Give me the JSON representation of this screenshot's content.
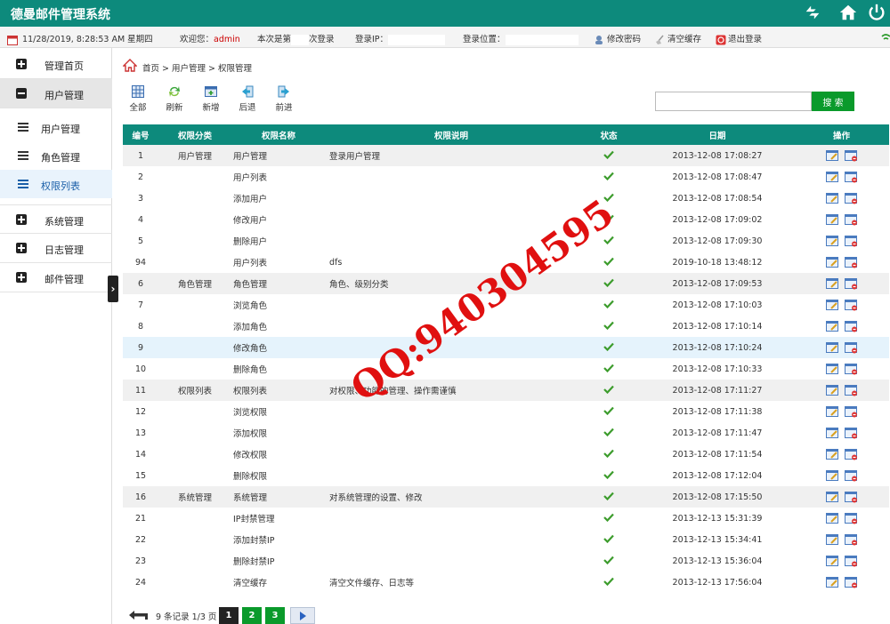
{
  "app": {
    "title": "德曼邮件管理系统"
  },
  "info": {
    "datetime": "11/28/2019, 8:28:53 AM 星期四",
    "welcome_prefix": "欢迎您：",
    "user": "admin",
    "login_count_prefix": "本次是第",
    "login_count_suffix": "次登录",
    "ip_label": "登录IP：",
    "location_label": "登录位置：",
    "change_password": "修改密码",
    "clear_cache": "清空缓存",
    "logout": "退出登录"
  },
  "sidebar": {
    "items": [
      {
        "label": "管理首页",
        "expanded": false
      },
      {
        "label": "用户管理",
        "expanded": true,
        "active": true
      },
      {
        "label": "系统管理",
        "expanded": false
      },
      {
        "label": "日志管理",
        "expanded": false
      },
      {
        "label": "邮件管理",
        "expanded": false
      }
    ],
    "sub_items": [
      {
        "label": "用户管理",
        "active": false
      },
      {
        "label": "角色管理",
        "active": false
      },
      {
        "label": "权限列表",
        "active": true
      }
    ]
  },
  "breadcrumb": {
    "text": "首页 > 用户管理 > 权限管理"
  },
  "toolbar": {
    "all": "全部",
    "refresh": "刷新",
    "add": "新增",
    "back": "后退",
    "forward": "前进"
  },
  "search": {
    "placeholder": "",
    "button": "搜 索"
  },
  "table": {
    "headers": [
      "编号",
      "权限分类",
      "权限名称",
      "权限说明",
      "状态",
      "日期",
      "操作"
    ],
    "rows": [
      {
        "id": "1",
        "category": "用户管理",
        "name": "用户管理",
        "desc": "登录用户管理",
        "date": "2013-12-08 17:08:27",
        "group": true
      },
      {
        "id": "2",
        "category": "",
        "name": "用户列表",
        "desc": "",
        "date": "2013-12-08 17:08:47"
      },
      {
        "id": "3",
        "category": "",
        "name": "添加用户",
        "desc": "",
        "date": "2013-12-08 17:08:54"
      },
      {
        "id": "4",
        "category": "",
        "name": "修改用户",
        "desc": "",
        "date": "2013-12-08 17:09:02"
      },
      {
        "id": "5",
        "category": "",
        "name": "删除用户",
        "desc": "",
        "date": "2013-12-08 17:09:30"
      },
      {
        "id": "94",
        "category": "",
        "name": "用户列表",
        "desc": "dfs",
        "date": "2019-10-18 13:48:12"
      },
      {
        "id": "6",
        "category": "角色管理",
        "name": "角色管理",
        "desc": "角色、级别分类",
        "date": "2013-12-08 17:09:53",
        "group": true
      },
      {
        "id": "7",
        "category": "",
        "name": "浏览角色",
        "desc": "",
        "date": "2013-12-08 17:10:03"
      },
      {
        "id": "8",
        "category": "",
        "name": "添加角色",
        "desc": "",
        "date": "2013-12-08 17:10:14"
      },
      {
        "id": "9",
        "category": "",
        "name": "修改角色",
        "desc": "",
        "date": "2013-12-08 17:10:24",
        "highlight": true
      },
      {
        "id": "10",
        "category": "",
        "name": "删除角色",
        "desc": "",
        "date": "2013-12-08 17:10:33"
      },
      {
        "id": "11",
        "category": "权限列表",
        "name": "权限列表",
        "desc": "对权限、功能的管理、操作需谨慎",
        "date": "2013-12-08 17:11:27",
        "group": true
      },
      {
        "id": "12",
        "category": "",
        "name": "浏览权限",
        "desc": "",
        "date": "2013-12-08 17:11:38"
      },
      {
        "id": "13",
        "category": "",
        "name": "添加权限",
        "desc": "",
        "date": "2013-12-08 17:11:47"
      },
      {
        "id": "14",
        "category": "",
        "name": "修改权限",
        "desc": "",
        "date": "2013-12-08 17:11:54"
      },
      {
        "id": "15",
        "category": "",
        "name": "删除权限",
        "desc": "",
        "date": "2013-12-08 17:12:04"
      },
      {
        "id": "16",
        "category": "系统管理",
        "name": "系统管理",
        "desc": "对系统管理的设置、修改",
        "date": "2013-12-08 17:15:50",
        "group": true
      },
      {
        "id": "21",
        "category": "",
        "name": "IP封禁管理",
        "desc": "",
        "date": "2013-12-13 15:31:39"
      },
      {
        "id": "22",
        "category": "",
        "name": "添加封禁IP",
        "desc": "",
        "date": "2013-12-13 15:34:41"
      },
      {
        "id": "23",
        "category": "",
        "name": "删除封禁IP",
        "desc": "",
        "date": "2013-12-13 15:36:04"
      },
      {
        "id": "24",
        "category": "",
        "name": "清空缓存",
        "desc": "清空文件缓存、日志等",
        "date": "2013-12-13 17:56:04"
      }
    ]
  },
  "pagination": {
    "info": "9 条记录 1/3 页",
    "pages": [
      "1",
      "2",
      "3"
    ],
    "current": 0
  },
  "watermark": {
    "text": "QQ:940304595"
  },
  "colors": {
    "primary": "#0d8a7c",
    "green_button": "#0a9a2b",
    "watermark": "#e01010"
  }
}
